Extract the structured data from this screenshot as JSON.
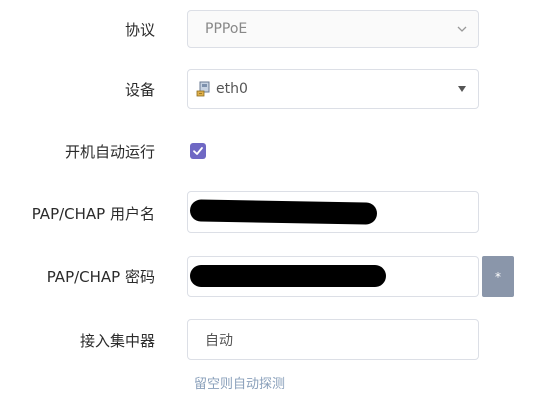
{
  "protocol": {
    "label": "协议",
    "value": "PPPoE"
  },
  "device": {
    "label": "设备",
    "value": "eth0",
    "icon": "network-device-icon"
  },
  "autostart": {
    "label": "开机自动运行",
    "checked": true
  },
  "username": {
    "label": "PAP/CHAP 用户名",
    "value": ""
  },
  "password": {
    "label": "PAP/CHAP 密码",
    "value": "",
    "reveal_label": "*"
  },
  "concentrator": {
    "label": "接入集中器",
    "value": "自动",
    "hint": "留空则自动探测"
  },
  "colors": {
    "accent": "#6f68c4",
    "reveal_button": "#8a96aa",
    "hint": "#8aa0bb",
    "border": "#dcdfe6"
  }
}
